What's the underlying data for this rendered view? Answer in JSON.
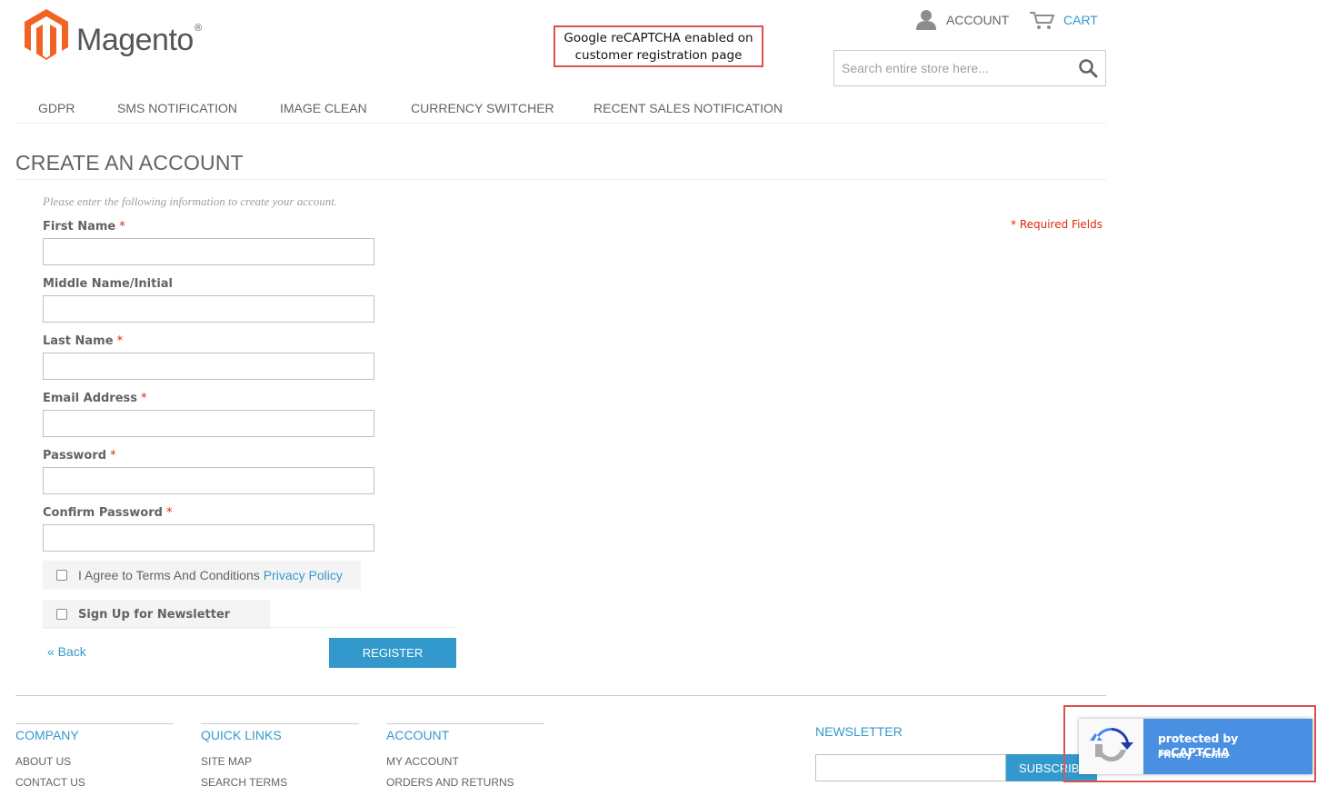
{
  "brand": {
    "logo_text": "Magento",
    "logo_reg": "®"
  },
  "annotations": {
    "top_line1": "Google reCAPTCHA enabled on",
    "top_line2": "customer registration page"
  },
  "header": {
    "account_label": "ACCOUNT",
    "cart_label": "CART",
    "search_placeholder": "Search entire store here..."
  },
  "nav": {
    "items": [
      {
        "label": "GDPR"
      },
      {
        "label": "SMS NOTIFICATION"
      },
      {
        "label": "IMAGE CLEAN"
      },
      {
        "label": "CURRENCY SWITCHER"
      },
      {
        "label": "RECENT SALES NOTIFICATION"
      }
    ]
  },
  "page": {
    "title": "CREATE AN ACCOUNT",
    "intro": "Please enter the following information to create your account.",
    "required_note": "* Required Fields"
  },
  "form": {
    "fields": [
      {
        "label": "First Name",
        "required": "*",
        "value": ""
      },
      {
        "label": "Middle Name/Initial",
        "required": "",
        "value": ""
      },
      {
        "label": "Last Name",
        "required": "*",
        "value": ""
      },
      {
        "label": "Email Address",
        "required": "*",
        "value": ""
      },
      {
        "label": "Password",
        "required": "*",
        "value": ""
      },
      {
        "label": "Confirm Password",
        "required": "*",
        "value": ""
      }
    ],
    "agree_label": "I Agree to Terms And Conditions",
    "privacy_link": "Privacy Policy",
    "newsletter_label": "Sign Up for Newsletter",
    "back_label": "« Back",
    "register_label": "REGISTER"
  },
  "footer": {
    "columns": [
      {
        "title": "COMPANY",
        "links": [
          "ABOUT US",
          "CONTACT US"
        ]
      },
      {
        "title": "QUICK LINKS",
        "links": [
          "SITE MAP",
          "SEARCH TERMS"
        ]
      },
      {
        "title": "ACCOUNT",
        "links": [
          "MY ACCOUNT",
          "ORDERS AND RETURNS"
        ]
      }
    ],
    "newsletter_title": "NEWSLETTER",
    "subscribe_label": "SUBSCRIBE"
  },
  "recaptcha": {
    "title": "protected by reCAPTCHA",
    "privacy": "Privacy",
    "separator": " - ",
    "terms": "Terms"
  },
  "colors": {
    "accent": "#3399cc",
    "required": "#df280a",
    "annotation": "#d9534f",
    "recaptcha_blue": "#4a90e2"
  }
}
